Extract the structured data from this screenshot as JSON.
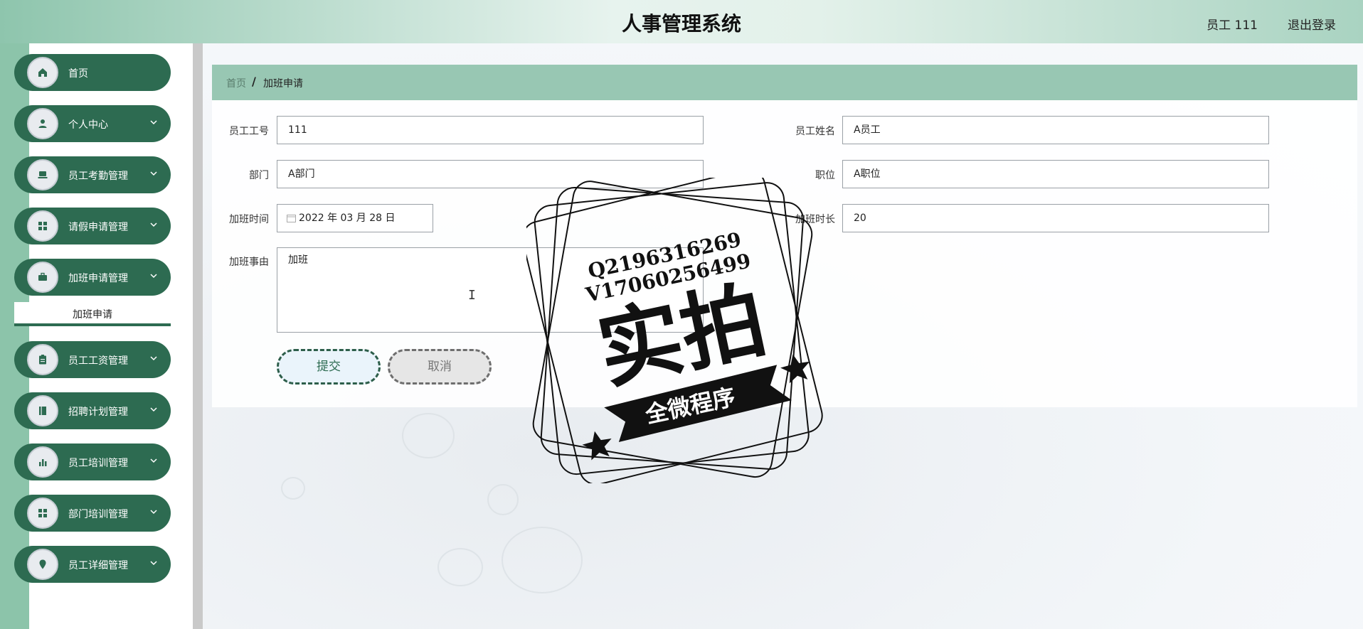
{
  "header": {
    "title": "人事管理系统",
    "user": "员工 111",
    "logout": "退出登录"
  },
  "sidebar": {
    "items": [
      {
        "label": "首页",
        "icon": "home-icon",
        "has_children": false
      },
      {
        "label": "个人中心",
        "icon": "user-icon",
        "has_children": true
      },
      {
        "label": "员工考勤管理",
        "icon": "laptop-icon",
        "has_children": true
      },
      {
        "label": "请假申请管理",
        "icon": "grid-icon",
        "has_children": true
      },
      {
        "label": "加班申请管理",
        "icon": "briefcase-icon",
        "has_children": true
      },
      {
        "label": "员工工资管理",
        "icon": "clipboard-icon",
        "has_children": true
      },
      {
        "label": "招聘计划管理",
        "icon": "book-icon",
        "has_children": true
      },
      {
        "label": "员工培训管理",
        "icon": "bar-chart-icon",
        "has_children": true
      },
      {
        "label": "部门培训管理",
        "icon": "grid-icon",
        "has_children": true
      },
      {
        "label": "员工详细管理",
        "icon": "map-pin-icon",
        "has_children": true
      }
    ],
    "active_submenu": "加班申请"
  },
  "breadcrumb": {
    "home": "首页",
    "separator": "/",
    "current": "加班申请"
  },
  "form": {
    "employee_id": {
      "label": "员工工号",
      "value": "111"
    },
    "employee_name": {
      "label": "员工姓名",
      "value": "A员工"
    },
    "department": {
      "label": "部门",
      "value": "A部门"
    },
    "position": {
      "label": "职位",
      "value": "A职位"
    },
    "overtime_date": {
      "label": "加班时间",
      "value": "2022 年 03 月 28 日"
    },
    "overtime_hours": {
      "label": "加班时长",
      "value": "20"
    },
    "reason": {
      "label": "加班事由",
      "value": "加班"
    },
    "submit_label": "提交",
    "cancel_label": "取消"
  },
  "watermark": {
    "line1": "Q2196316269",
    "line2": "V17060256499",
    "main": "实拍",
    "ribbon": "全微程序"
  },
  "colors": {
    "primary": "#2d6b51",
    "breadcrumb_bg": "#98c7b3",
    "strip": "#8cc4aa"
  }
}
